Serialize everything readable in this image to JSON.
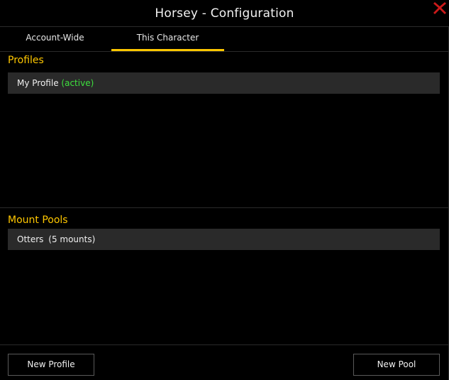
{
  "window": {
    "title": "Horsey - Configuration"
  },
  "tabs": [
    {
      "label": "Account-Wide",
      "active": false
    },
    {
      "label": "This Character",
      "active": true
    }
  ],
  "profiles": {
    "title": "Profiles",
    "items": [
      {
        "name": "My Profile",
        "status": "(active)"
      }
    ]
  },
  "pools": {
    "title": "Mount Pools",
    "items": [
      {
        "name": "Otters",
        "count": "(5 mounts)"
      }
    ]
  },
  "footer": {
    "new_profile_label": "New Profile",
    "new_pool_label": "New Pool"
  },
  "colors": {
    "accent": "#ffc700",
    "active_status": "#3ee03e",
    "close": "#cc1a1a"
  }
}
